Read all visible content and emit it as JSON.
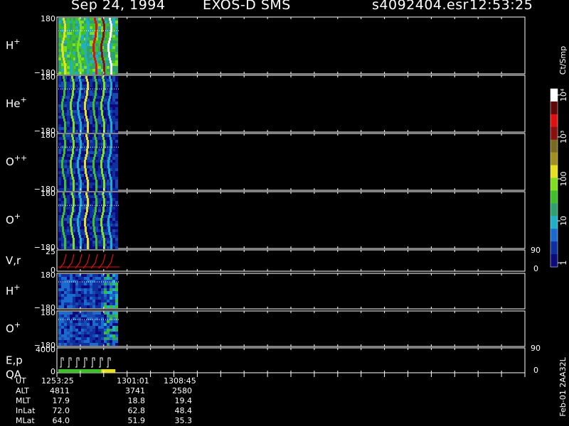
{
  "header": {
    "date": "Sep 24, 1994",
    "mission": "EXOS-D SMS",
    "file": "s4092404.esr",
    "time": "12:53:25"
  },
  "colorbar": {
    "unit_label": "Ct/Smp",
    "tick_labels": [
      "1",
      "10",
      "100",
      "10³",
      "10⁴"
    ],
    "tick_values": [
      1,
      10,
      100,
      1000,
      10000
    ],
    "scale": "log",
    "colors": [
      "#0a0a7a",
      "#0f2fa0",
      "#1a6ad0",
      "#1fb0c8",
      "#2fa070",
      "#3fc02a",
      "#7fe020",
      "#e6e020",
      "#a09020",
      "#7a6a20",
      "#8a1010",
      "#e01010",
      "#600808",
      "#ffffff"
    ]
  },
  "version_label": "Feb-01 2AA32L",
  "ephemeris": {
    "rows": [
      {
        "label": "UT",
        "values": [
          "1253:25",
          "1301:01",
          "1308:45"
        ]
      },
      {
        "label": "ALT",
        "values": [
          "4811",
          "3741",
          "2580"
        ]
      },
      {
        "label": "MLT",
        "values": [
          "17.9",
          "18.8",
          "19.4"
        ]
      },
      {
        "label": "InLat",
        "values": [
          "72.0",
          "62.8",
          "48.4"
        ]
      },
      {
        "label": "MLat",
        "values": [
          "64.0",
          "51.9",
          "35.3"
        ]
      }
    ]
  },
  "chart_data": {
    "type": "heatmap",
    "x_time_ticks": [
      "1253:25",
      "1301:01",
      "1308:45"
    ],
    "data_fraction_of_axis": 0.125,
    "panels": [
      {
        "id": "h_plus",
        "label": "H",
        "sup": "+",
        "ytop": "180",
        "ybot": "−180",
        "kind": "spectrogram",
        "palette": "hplus"
      },
      {
        "id": "he_plus",
        "label": "He",
        "sup": "+",
        "ytop": "180",
        "ybot": "−180",
        "kind": "spectrogram",
        "palette": "minor"
      },
      {
        "id": "o_pp",
        "label": "O",
        "sup": "++",
        "ytop": "180",
        "ybot": "−180",
        "kind": "spectrogram",
        "palette": "minor"
      },
      {
        "id": "o_plus",
        "label": "O",
        "sup": "+",
        "ytop": "180",
        "ybot": "−180",
        "kind": "spectrogram",
        "palette": "minor"
      },
      {
        "id": "vr",
        "label": "V,r",
        "sup": "",
        "ytop": "25",
        "ybot": "0",
        "rtop": "90",
        "rbot": "0",
        "kind": "line"
      },
      {
        "id": "h_plus_2",
        "label": "H",
        "sup": "+",
        "ytop": "180",
        "ybot": "−180",
        "kind": "spectrogram2",
        "palette": "low"
      },
      {
        "id": "o_plus_2",
        "label": "O",
        "sup": "+",
        "ytop": "180",
        "ybot": "−180",
        "kind": "spectrogram2",
        "palette": "low"
      },
      {
        "id": "ep",
        "label": "E,p",
        "label2": "QA",
        "sup": "",
        "ytop": "4000",
        "ybot": "0",
        "rtop": "90",
        "rbot": "0",
        "kind": "steps"
      }
    ]
  }
}
